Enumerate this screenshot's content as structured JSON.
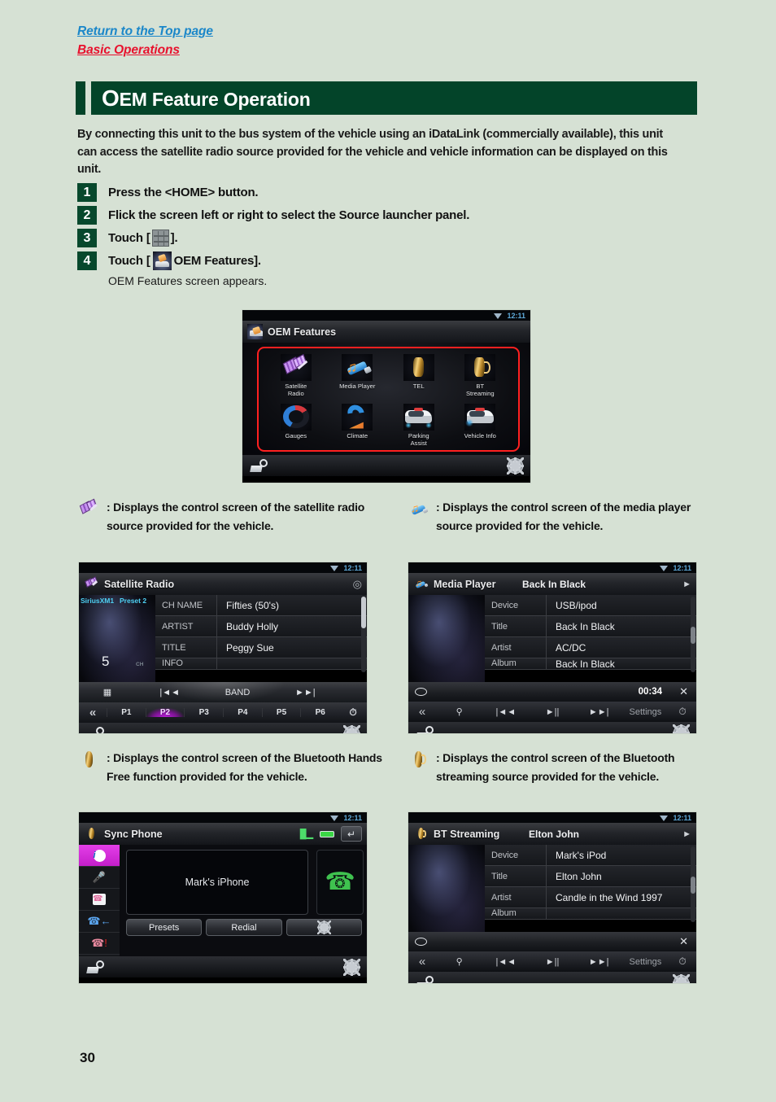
{
  "header": {
    "return_link": "Return to the Top page",
    "section_link": "Basic Operations"
  },
  "title": {
    "cap": "O",
    "rest": "EM Feature Operation"
  },
  "intro": "By connecting this unit to the bus system of the vehicle using an iDataLink (commercially available), this unit can access the satellite radio source provided for the vehicle and vehicle information can be displayed on this unit.",
  "steps": [
    {
      "num": "1",
      "pre": "Press the <HOME> button.",
      "post": "",
      "icon": ""
    },
    {
      "num": "2",
      "pre": "Flick the screen left or right to select the Source launcher panel.",
      "post": "",
      "icon": ""
    },
    {
      "num": "3",
      "pre": "Touch [",
      "post": "].",
      "icon": "grid-icon"
    },
    {
      "num": "4",
      "pre": "Touch [",
      "post": "OEM Features].",
      "icon": "oem-features-icon",
      "sub": "OEM Features screen appears."
    }
  ],
  "oem_screen": {
    "statusbar": {
      "clock": "12:11",
      "wifi": "wifi-icon"
    },
    "header_title": "OEM Features",
    "items": [
      {
        "label": "Satellite\nRadio",
        "label_line1": "Satellite",
        "label_line2": "Radio",
        "icon": "satellite-radio-icon"
      },
      {
        "label": "Media Player",
        "label_line1": "Media Player",
        "label_line2": "",
        "icon": "media-player-icon"
      },
      {
        "label": "TEL",
        "label_line1": "TEL",
        "label_line2": "",
        "icon": "tel-icon"
      },
      {
        "label": "BT Streaming",
        "label_line1": "BT",
        "label_line2": "Streaming",
        "icon": "bt-streaming-icon"
      },
      {
        "label": "Gauges",
        "label_line1": "Gauges",
        "label_line2": "",
        "icon": "gauges-icon"
      },
      {
        "label": "Climate",
        "label_line1": "Climate",
        "label_line2": "",
        "icon": "climate-icon"
      },
      {
        "label": "Parking Assist",
        "label_line1": "Parking",
        "label_line2": "Assist",
        "icon": "parking-assist-icon"
      },
      {
        "label": "Vehicle Info",
        "label_line1": "Vehicle Info",
        "label_line2": "",
        "icon": "vehicle-info-icon"
      }
    ],
    "highlight_color": "#ff2020"
  },
  "descriptions": [
    {
      "icon": "satellite-radio-icon",
      "text": ": Displays the control screen of the satellite radio source provided for the vehicle."
    },
    {
      "icon": "media-player-icon",
      "text": ": Displays the control screen of the media player source provided for the vehicle."
    },
    {
      "icon": "tel-icon",
      "text": ": Displays the control screen of the Bluetooth Hands Free function provided for the vehicle."
    },
    {
      "icon": "bt-streaming-icon",
      "text": ": Displays the control screen of the Bluetooth streaming source provided for the vehicle."
    }
  ],
  "satellite_radio_screen": {
    "clock": "12:11",
    "title": "Satellite Radio",
    "band_label": "SiriusXM1",
    "preset_label": "Preset 2",
    "channel_number": "5",
    "channel_unit": "CH",
    "rows": [
      {
        "key": "CH NAME",
        "value": "Fifties (50's)"
      },
      {
        "key": "ARTIST",
        "value": "Buddy Holly"
      },
      {
        "key": "TITLE",
        "value": "Peggy Sue"
      },
      {
        "key": "INFO",
        "value": ""
      }
    ],
    "controls": {
      "keypad": "keypad-icon",
      "prev": "|◄◄",
      "band": "BAND",
      "next": "►►|"
    },
    "presets": [
      "P1",
      "P2",
      "P3",
      "P4",
      "P5",
      "P6"
    ],
    "active_preset": "P2",
    "left_arrow": "«",
    "right_icon": "antenna-icon",
    "footer": {
      "left": "source-list-icon",
      "right": "gear-icon"
    }
  },
  "media_player_screen": {
    "clock": "12:11",
    "title": "Media Player",
    "now_playing": "Back In Black",
    "play_indicator": "►",
    "rows": [
      {
        "key": "Device",
        "value": "USB/ipod"
      },
      {
        "key": "Title",
        "value": "Back In Black"
      },
      {
        "key": "Artist",
        "value": "AC/DC"
      },
      {
        "key": "Album",
        "value": "Back In Black"
      }
    ],
    "time": "00:34",
    "repeat": "repeat-icon",
    "shuffle": "✕",
    "controls": {
      "back": "«",
      "search": "search-icon",
      "prev": "|◄◄",
      "play": "►||",
      "next": "►►|",
      "settings": "Settings",
      "antenna": "antenna-icon"
    },
    "footer": {
      "left": "source-list-icon",
      "right": "gear-icon"
    }
  },
  "sync_phone_screen": {
    "clock": "12:11",
    "title": "Sync Phone",
    "signal": "signal-icon",
    "battery": "battery-icon",
    "back": "return-icon",
    "device_name": "Mark's iPhone",
    "side_items": [
      "info-icon",
      "voice-icon",
      "dialpad-icon",
      "incoming-call-icon",
      "missed-call-icon"
    ],
    "buttons": [
      "Presets",
      "Redial",
      "settings-gear-icon"
    ],
    "call_button": "call-handset-icon",
    "footer": {
      "left": "source-list-icon",
      "right": "gear-icon"
    }
  },
  "bt_streaming_screen": {
    "clock": "12:11",
    "title": "BT Streaming",
    "now_playing": "Elton John",
    "play_indicator": "►",
    "rows": [
      {
        "key": "Device",
        "value": "Mark's iPod"
      },
      {
        "key": "Title",
        "value": "Elton John"
      },
      {
        "key": "Artist",
        "value": "Candle in the Wind 1997"
      },
      {
        "key": "Album",
        "value": ""
      }
    ],
    "repeat": "repeat-icon",
    "shuffle": "✕",
    "controls": {
      "back": "«",
      "search": "search-icon",
      "prev": "|◄◄",
      "play": "►||",
      "next": "►►|",
      "settings": "Settings",
      "antenna": "antenna-icon"
    },
    "footer": {
      "left": "source-list-icon",
      "right": "gear-icon"
    }
  },
  "page_number": "30",
  "colors": {
    "page_bg": "#d6e1d4",
    "title_bg": "#034429",
    "link_blue": "#1b87c9",
    "link_red": "#e8112d",
    "highlight_red": "#ff2020",
    "accent_cyan": "#4fd2f5",
    "accent_magenta": "#c31ec9"
  }
}
